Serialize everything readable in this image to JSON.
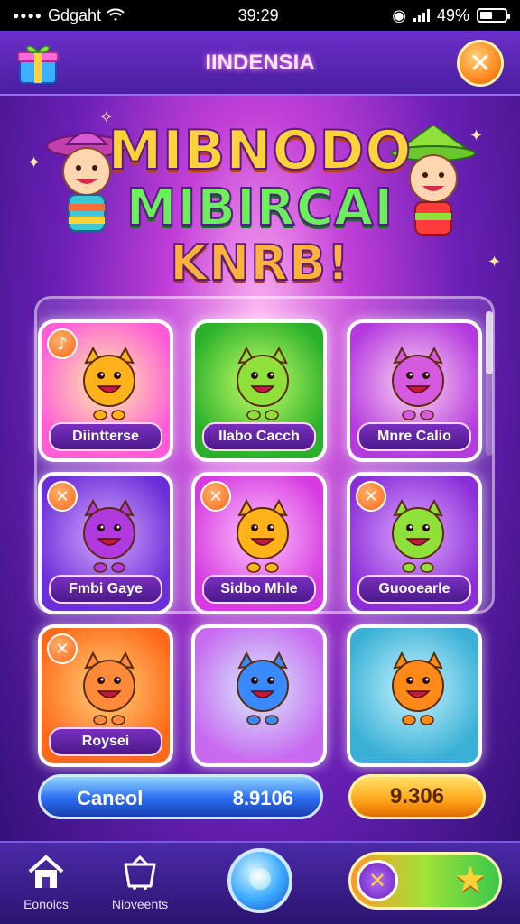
{
  "status_bar": {
    "carrier": "Gdgaht",
    "time": "39:29",
    "battery": "49%",
    "battery_level": 0.49
  },
  "header": {
    "title": "IINDENSIA",
    "close_symbol": "✕"
  },
  "banner": {
    "line1": "MIBNODO",
    "line2": "MIBIRCAI",
    "line3": "KNRB!"
  },
  "cards": [
    {
      "label": "Diintterse",
      "badge": "♪",
      "bg": [
        "#fff0a8",
        "#ff5cd6"
      ],
      "mascot_color": "#ffb21a"
    },
    {
      "label": "Ilabo Cacch",
      "badge": "",
      "bg": [
        "#c8ff6a",
        "#2ab02a"
      ],
      "mascot_color": "#8fe03a"
    },
    {
      "label": "Mnre Calio",
      "badge": "",
      "bg": [
        "#ffd6f0",
        "#b43ae0"
      ],
      "mascot_color": "#d65ae0"
    },
    {
      "label": "Fmbi Gaye",
      "badge": "✕",
      "bg": [
        "#d6a8ff",
        "#6a2fd8"
      ],
      "mascot_color": "#b03ae0"
    },
    {
      "label": "Sidbo Mhle",
      "badge": "✕",
      "bg": [
        "#ffc8ff",
        "#d63ae0"
      ],
      "mascot_color": "#ffb21a"
    },
    {
      "label": "Guooearle",
      "badge": "✕",
      "bg": [
        "#e0a8ff",
        "#8a2fd8"
      ],
      "mascot_color": "#8fe03a"
    },
    {
      "label": "Roysei",
      "badge": "✕",
      "bg": [
        "#ffd27a",
        "#ff6a1a"
      ],
      "mascot_color": "#ff8a3a"
    },
    {
      "label": "",
      "badge": "",
      "bg": [
        "#d6f0ff",
        "#c86af0"
      ],
      "mascot_color": "#3a8aff"
    },
    {
      "label": "",
      "badge": "",
      "bg": [
        "#c8f6ff",
        "#3ab0d6"
      ],
      "mascot_color": "#ff8a1a"
    }
  ],
  "actions": {
    "cancel_label": "Caneol",
    "cancel_value": "8.9106",
    "coins": "9.306"
  },
  "bottom_nav": {
    "home_label": "Eonoics",
    "gifts_label": "Nioveents"
  },
  "colors": {
    "accent_orange": "#ff8a1f",
    "accent_blue": "#2a6cf0",
    "header_purple": "#6b2fc9"
  }
}
